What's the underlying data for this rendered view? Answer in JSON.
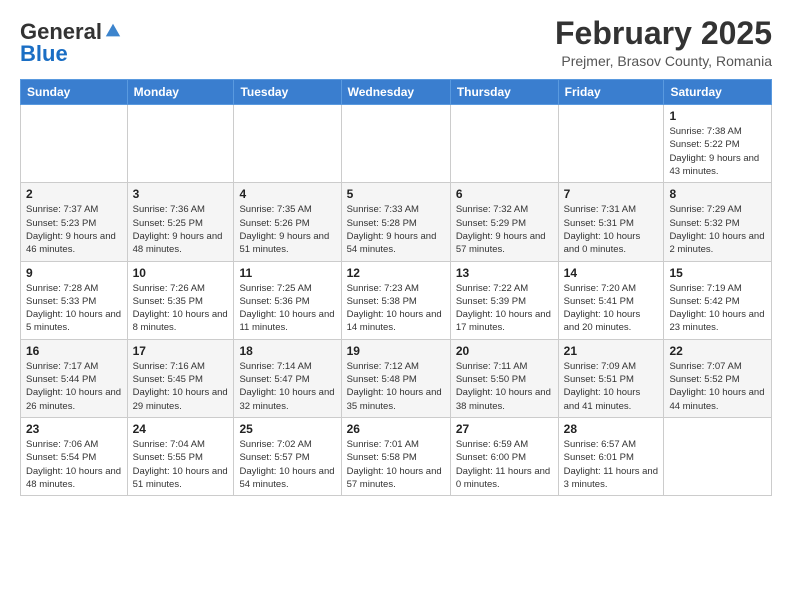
{
  "header": {
    "logo_general": "General",
    "logo_blue": "Blue",
    "month_title": "February 2025",
    "location": "Prejmer, Brasov County, Romania"
  },
  "weekdays": [
    "Sunday",
    "Monday",
    "Tuesday",
    "Wednesday",
    "Thursday",
    "Friday",
    "Saturday"
  ],
  "weeks": [
    {
      "days": [
        {
          "number": "",
          "info": ""
        },
        {
          "number": "",
          "info": ""
        },
        {
          "number": "",
          "info": ""
        },
        {
          "number": "",
          "info": ""
        },
        {
          "number": "",
          "info": ""
        },
        {
          "number": "",
          "info": ""
        },
        {
          "number": "1",
          "info": "Sunrise: 7:38 AM\nSunset: 5:22 PM\nDaylight: 9 hours and 43 minutes."
        }
      ]
    },
    {
      "days": [
        {
          "number": "2",
          "info": "Sunrise: 7:37 AM\nSunset: 5:23 PM\nDaylight: 9 hours and 46 minutes."
        },
        {
          "number": "3",
          "info": "Sunrise: 7:36 AM\nSunset: 5:25 PM\nDaylight: 9 hours and 48 minutes."
        },
        {
          "number": "4",
          "info": "Sunrise: 7:35 AM\nSunset: 5:26 PM\nDaylight: 9 hours and 51 minutes."
        },
        {
          "number": "5",
          "info": "Sunrise: 7:33 AM\nSunset: 5:28 PM\nDaylight: 9 hours and 54 minutes."
        },
        {
          "number": "6",
          "info": "Sunrise: 7:32 AM\nSunset: 5:29 PM\nDaylight: 9 hours and 57 minutes."
        },
        {
          "number": "7",
          "info": "Sunrise: 7:31 AM\nSunset: 5:31 PM\nDaylight: 10 hours and 0 minutes."
        },
        {
          "number": "8",
          "info": "Sunrise: 7:29 AM\nSunset: 5:32 PM\nDaylight: 10 hours and 2 minutes."
        }
      ]
    },
    {
      "days": [
        {
          "number": "9",
          "info": "Sunrise: 7:28 AM\nSunset: 5:33 PM\nDaylight: 10 hours and 5 minutes."
        },
        {
          "number": "10",
          "info": "Sunrise: 7:26 AM\nSunset: 5:35 PM\nDaylight: 10 hours and 8 minutes."
        },
        {
          "number": "11",
          "info": "Sunrise: 7:25 AM\nSunset: 5:36 PM\nDaylight: 10 hours and 11 minutes."
        },
        {
          "number": "12",
          "info": "Sunrise: 7:23 AM\nSunset: 5:38 PM\nDaylight: 10 hours and 14 minutes."
        },
        {
          "number": "13",
          "info": "Sunrise: 7:22 AM\nSunset: 5:39 PM\nDaylight: 10 hours and 17 minutes."
        },
        {
          "number": "14",
          "info": "Sunrise: 7:20 AM\nSunset: 5:41 PM\nDaylight: 10 hours and 20 minutes."
        },
        {
          "number": "15",
          "info": "Sunrise: 7:19 AM\nSunset: 5:42 PM\nDaylight: 10 hours and 23 minutes."
        }
      ]
    },
    {
      "days": [
        {
          "number": "16",
          "info": "Sunrise: 7:17 AM\nSunset: 5:44 PM\nDaylight: 10 hours and 26 minutes."
        },
        {
          "number": "17",
          "info": "Sunrise: 7:16 AM\nSunset: 5:45 PM\nDaylight: 10 hours and 29 minutes."
        },
        {
          "number": "18",
          "info": "Sunrise: 7:14 AM\nSunset: 5:47 PM\nDaylight: 10 hours and 32 minutes."
        },
        {
          "number": "19",
          "info": "Sunrise: 7:12 AM\nSunset: 5:48 PM\nDaylight: 10 hours and 35 minutes."
        },
        {
          "number": "20",
          "info": "Sunrise: 7:11 AM\nSunset: 5:50 PM\nDaylight: 10 hours and 38 minutes."
        },
        {
          "number": "21",
          "info": "Sunrise: 7:09 AM\nSunset: 5:51 PM\nDaylight: 10 hours and 41 minutes."
        },
        {
          "number": "22",
          "info": "Sunrise: 7:07 AM\nSunset: 5:52 PM\nDaylight: 10 hours and 44 minutes."
        }
      ]
    },
    {
      "days": [
        {
          "number": "23",
          "info": "Sunrise: 7:06 AM\nSunset: 5:54 PM\nDaylight: 10 hours and 48 minutes."
        },
        {
          "number": "24",
          "info": "Sunrise: 7:04 AM\nSunset: 5:55 PM\nDaylight: 10 hours and 51 minutes."
        },
        {
          "number": "25",
          "info": "Sunrise: 7:02 AM\nSunset: 5:57 PM\nDaylight: 10 hours and 54 minutes."
        },
        {
          "number": "26",
          "info": "Sunrise: 7:01 AM\nSunset: 5:58 PM\nDaylight: 10 hours and 57 minutes."
        },
        {
          "number": "27",
          "info": "Sunrise: 6:59 AM\nSunset: 6:00 PM\nDaylight: 11 hours and 0 minutes."
        },
        {
          "number": "28",
          "info": "Sunrise: 6:57 AM\nSunset: 6:01 PM\nDaylight: 11 hours and 3 minutes."
        },
        {
          "number": "",
          "info": ""
        }
      ]
    }
  ]
}
